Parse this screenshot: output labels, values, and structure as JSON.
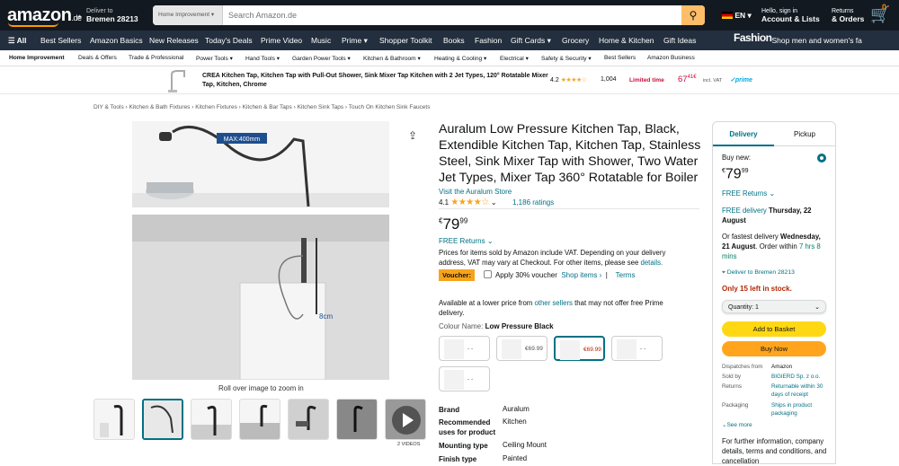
{
  "header": {
    "logo": "amazon",
    "logo_tld": ".de",
    "deliver_line1": "Deliver to",
    "deliver_line2": "Bremen 28213",
    "search_category": "Home Improvement",
    "search_placeholder": "Search Amazon.de",
    "lang": "EN",
    "account_line1": "Hello, sign in",
    "account_line2": "Account & Lists",
    "returns_line1": "Returns",
    "returns_line2": "& Orders",
    "cart_count": "0",
    "cart_label": "Cart"
  },
  "nav_main": {
    "all": "All",
    "items": [
      "Best Sellers",
      "Amazon Basics",
      "New Releases",
      "Today's Deals",
      "Prime Video",
      "Music",
      "Prime",
      "Shopper Toolkit",
      "Books",
      "Fashion",
      "Gift Cards",
      "Grocery",
      "Home & Kitchen",
      "Gift Ideas"
    ],
    "promo_brand": "Fashion",
    "promo_text": "Shop men and women's fa"
  },
  "nav_sub": [
    "Home Improvement",
    "Deals & Offers",
    "Trade & Professional",
    "Power Tools",
    "Hand Tools",
    "Garden Power Tools",
    "Kitchen & Bathroom",
    "Heating & Cooling",
    "Electrical",
    "Safety & Security",
    "Best Sellers",
    "Amazon Business"
  ],
  "banner": {
    "title": "CREA Kitchen Tap, Kitchen Tap with Pull-Out Shower, Sink Mixer Tap Kitchen with 2 Jet Types, 120° Rotatable Mixer Tap, Kitchen, Chrome",
    "rating": "4.2",
    "stars": "★★★★☆",
    "count": "1,004",
    "limited": "Limited time",
    "price": "67",
    "price_frac": "41",
    "currency": "€",
    "vat": "incl. VAT",
    "prime": "✓prime"
  },
  "breadcrumb": [
    "DIY & Tools",
    "Kitchen & Bath Fixtures",
    "Kitchen Fixtures",
    "Kitchen & Bar Taps",
    "Kitchen Sink Taps",
    "Touch On Kitchen Sink Faucets"
  ],
  "gallery": {
    "max_label": "MAX:400mm",
    "cm_label": "8cm",
    "roll_text": "Roll over image to zoom in",
    "videos": "2 VIDEOS"
  },
  "product": {
    "title": "Auralum Low Pressure Kitchen Tap, Black, Extendible Kitchen Tap, Kitchen Tap, Stainless Steel, Sink Mixer Tap with Shower, Two Water Jet Types, Mixer Tap 360° Rotatable for Boiler",
    "store": "Visit the Auralum Store",
    "rating": "4.1",
    "stars": "★★★★☆",
    "ratings_count": "1,186 ratings",
    "currency": "€",
    "price": "79",
    "price_frac": "99",
    "free_returns": "FREE Returns",
    "vat_note_a": "Prices for items sold by Amazon include VAT. Depending on your delivery address, VAT may vary at Checkout. For other items, please see ",
    "vat_note_link": "details.",
    "voucher_badge": "Voucher:",
    "voucher_text": "Apply 30% voucher",
    "shop_items": "Shop items ›",
    "terms": "Terms",
    "avail_a": "Available at a lower price from ",
    "avail_link": "other sellers",
    "avail_b": " that may not offer free Prime delivery.",
    "colour_label": "Colour Name:",
    "colour_value": "Low Pressure Black",
    "swatches": [
      {
        "price": "- -",
        "selected": false
      },
      {
        "price": "€69.99",
        "selected": false
      },
      {
        "price": "€69.99",
        "selected": true
      },
      {
        "price": "- -",
        "selected": false
      },
      {
        "price": "- -",
        "selected": false
      }
    ],
    "specs": [
      {
        "k": "Brand",
        "v": "Auralum"
      },
      {
        "k": "Recommended uses for product",
        "v": "Kitchen"
      },
      {
        "k": "Mounting type",
        "v": "Ceiling Mount"
      },
      {
        "k": "Finish type",
        "v": "Painted"
      }
    ]
  },
  "buybox": {
    "tab_delivery": "Delivery",
    "tab_pickup": "Pickup",
    "buy_new": "Buy new:",
    "currency": "€",
    "price": "79",
    "price_frac": "99",
    "free_returns": "FREE Returns",
    "free_delivery": "FREE delivery",
    "delivery_date": "Thursday, 22 August",
    "fastest_a": "Or fastest delivery ",
    "fastest_date": "Wednesday, 21 August",
    "fastest_b": ". Order within ",
    "fastest_time": "7 hrs 8 mins",
    "deliver_to": "Deliver to Bremen 28213",
    "stock": "Only 15 left in stock.",
    "quantity": "Quantity:  1",
    "add_basket": "Add to Basket",
    "buy_now": "Buy Now",
    "meta": [
      {
        "k": "Dispatches from",
        "v": "Amazon"
      },
      {
        "k": "Sold by",
        "v": "BIGIERD Sp. z o.o."
      },
      {
        "k": "Returns",
        "v": "Returnable within 30 days of receipt"
      },
      {
        "k": "Packaging",
        "v": "Ships in product packaging"
      }
    ],
    "see_more": "See more",
    "further": "For further information, company details, terms and conditions, and cancellation"
  },
  "colors": {
    "nav_dark": "#131921",
    "nav_mid": "#232f3e",
    "accent": "#febd69",
    "orange": "#ff9900",
    "link": "#007185",
    "price_red": "#cc0c39",
    "add_btn": "#ffd814",
    "buy_btn": "#ffa41c"
  }
}
